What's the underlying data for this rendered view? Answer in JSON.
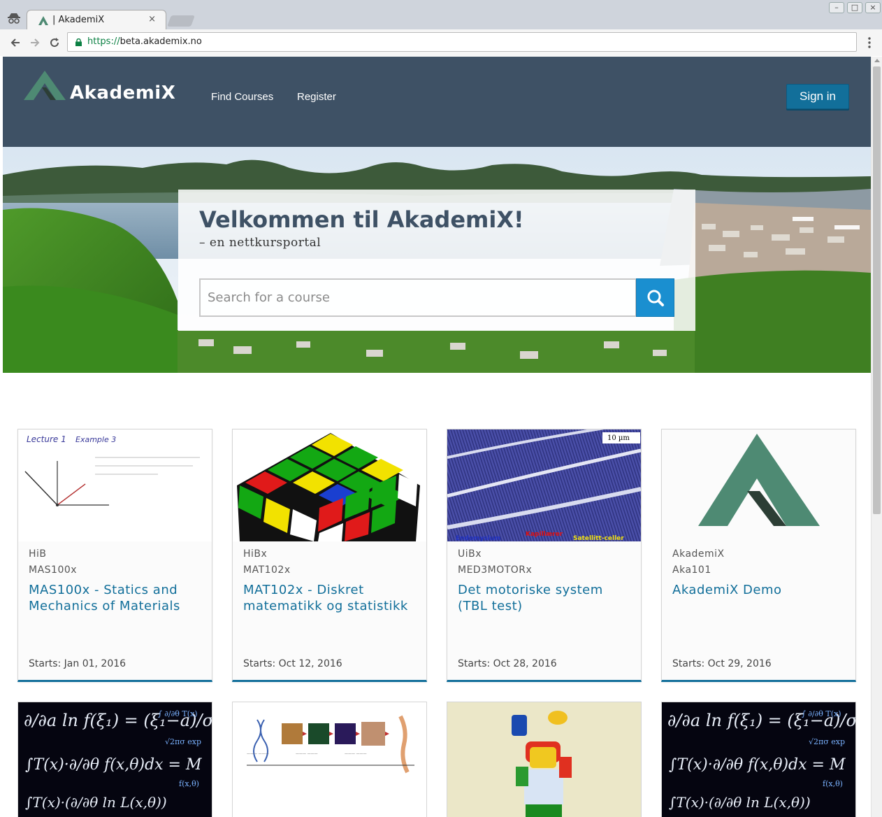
{
  "browser": {
    "tab_title": "| AkademiX",
    "tab_close": "×",
    "url_scheme": "https://",
    "url_host": "beta.akademix.no",
    "back_icon": "arrow-left-icon",
    "forward_icon": "arrow-right-icon",
    "reload_icon": "reload-icon",
    "menu_icon": "kebab-menu-icon",
    "window_buttons": [
      "–",
      "□",
      "×"
    ]
  },
  "header": {
    "logo_text": "AkademiX",
    "nav": [
      "Find Courses",
      "Register"
    ],
    "signin_label": "Sign in",
    "colors": {
      "header_bg": "#3e5165",
      "accent": "#126f9a",
      "logo_green": "#4e8a73"
    }
  },
  "hero": {
    "title": "Velkommen til AkademiX!",
    "subtitle": "– en nettkursportal",
    "search_placeholder": "Search for a course",
    "search_icon": "search-icon"
  },
  "courses": [
    {
      "org": "HiB",
      "code": "MAS100x",
      "title": "MAS100x - Statics and Mechanics of Materials",
      "start": "Starts: Jan 01, 2016",
      "image": "lecture-whiteboard",
      "image_text": [
        "Lecture 1",
        "Example 3"
      ]
    },
    {
      "org": "HiBx",
      "code": "MAT102x",
      "title": "MAT102x - Diskret matematikk og statistikk",
      "start": "Starts: Oct 12, 2016",
      "image": "rubiks-cube"
    },
    {
      "org": "UiBx",
      "code": "MED3MOTORx",
      "title": "Det motoriske system (TBL test)",
      "start": "Starts: Oct 28, 2016",
      "image": "muscle-histology",
      "image_text": [
        "10 µm",
        "Endomysium",
        "Kapillærer",
        "Satellitt-celler"
      ]
    },
    {
      "org": "AkademiX",
      "code": "Aka101",
      "title": "AkademiX Demo",
      "start": "Starts: Oct 29, 2016",
      "image": "akademix-logo"
    }
  ],
  "courses_row2": [
    {
      "image": "math-formulas"
    },
    {
      "image": "biology-diagram"
    },
    {
      "image": "lego-juggler"
    },
    {
      "image": "math-formulas"
    }
  ]
}
